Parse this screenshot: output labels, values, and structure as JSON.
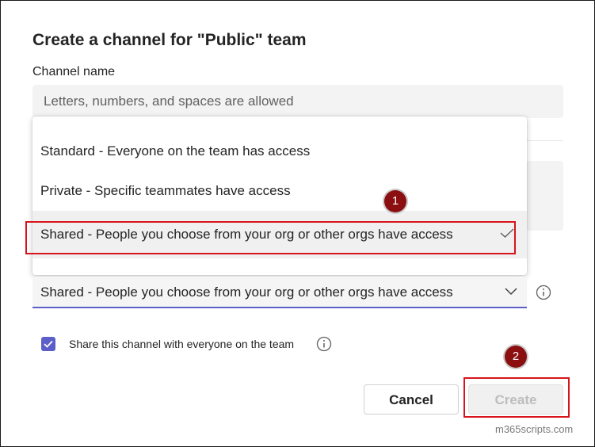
{
  "dialog": {
    "title": "Create a channel for \"Public\" team",
    "channel_name_label": "Channel name",
    "channel_name_placeholder": "Letters, numbers, and spaces are allowed"
  },
  "privacy_menu": {
    "options": [
      {
        "label": "Standard - Everyone on the team has access",
        "selected": false
      },
      {
        "label": "Private - Specific teammates have access",
        "selected": false
      },
      {
        "label": "Shared - People you choose from your org or other orgs have access",
        "selected": true
      }
    ]
  },
  "privacy_select": {
    "value": "Shared - People you choose from your org or other orgs have access"
  },
  "share_option": {
    "label": "Share this channel with everyone on the team",
    "checked": true
  },
  "buttons": {
    "cancel": "Cancel",
    "create": "Create"
  },
  "annotations": {
    "step1": "1",
    "step2": "2"
  },
  "watermark": "m365scripts.com",
  "colors": {
    "accent": "#5b5fc7",
    "annotation_red": "#d7141b",
    "badge": "#8b0e10"
  }
}
